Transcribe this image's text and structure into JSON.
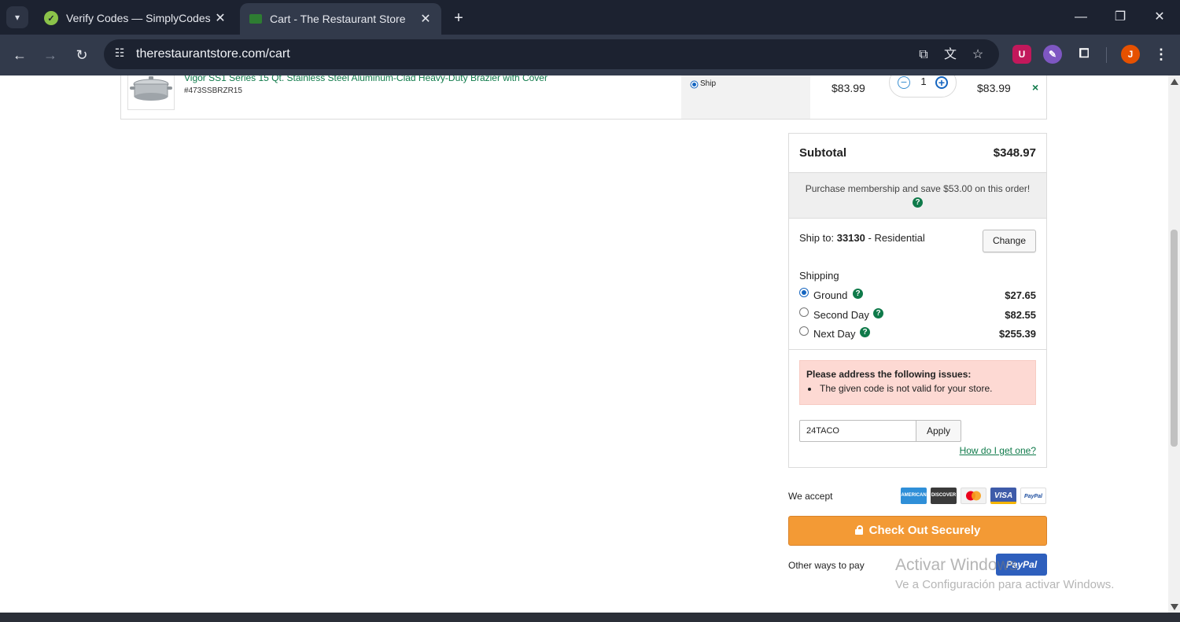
{
  "browser": {
    "tabs": [
      {
        "title": "Verify Codes — SimplyCodes",
        "active": false,
        "favicon_color": "#8bc34a"
      },
      {
        "title": "Cart - The Restaurant Store",
        "active": true,
        "favicon_color": "#2e7d32"
      }
    ],
    "url": "therestaurantstore.com/cart",
    "profile_initial": "J"
  },
  "cart_item": {
    "name": "Vigor SS1 Series 15 Qt. Stainless Steel Aluminum-Clad Heavy-Duty Brazier with Cover",
    "sku": "#473SSBRZR15",
    "fulfillment": "Ship",
    "unit_price": "$83.99",
    "quantity": "1",
    "line_total": "$83.99",
    "remove_label": "×"
  },
  "summary": {
    "subtotal_label": "Subtotal",
    "subtotal_value": "$348.97",
    "membership_text": "Purchase membership and save $53.00 on this order!",
    "ship_to_label": "Ship to:",
    "ship_to_zip": "33130",
    "ship_to_type": "- Residential",
    "change_label": "Change",
    "shipping_heading": "Shipping",
    "shipping_options": [
      {
        "name": "Ground",
        "cost": "$27.65",
        "selected": true
      },
      {
        "name": "Second Day",
        "cost": "$82.55",
        "selected": false
      },
      {
        "name": "Next Day",
        "cost": "$255.39",
        "selected": false
      }
    ],
    "alert_title": "Please address the following issues:",
    "alert_item": "The given code is not valid for your store.",
    "promo_code": "24TACO",
    "apply_label": "Apply",
    "how_get_label": "How do I get one?"
  },
  "payment": {
    "we_accept_label": "We accept",
    "cards": [
      {
        "name": "AMERICAN EXPRESS",
        "color": "#2f8fd8",
        "text_color": "#ffffff"
      },
      {
        "name": "DISCOVER",
        "color": "#3a3a3a",
        "text_color": "#ffffff"
      },
      {
        "name": "mastercard",
        "color": "#f2f2f2",
        "text_color": "#222222"
      },
      {
        "name": "VISA",
        "color": "#3e5ba9",
        "text_color": "#ffffff"
      },
      {
        "name": "PayPal",
        "color": "#ffffff",
        "text_color": "#1f4fa0"
      }
    ],
    "checkout_label": "Check Out Securely",
    "other_ways_label": "Other ways to pay",
    "paypal_label": "PayPal"
  },
  "watermark": {
    "line1": "Activar Windows",
    "line2": "Ve a Configuración para activar Windows."
  }
}
